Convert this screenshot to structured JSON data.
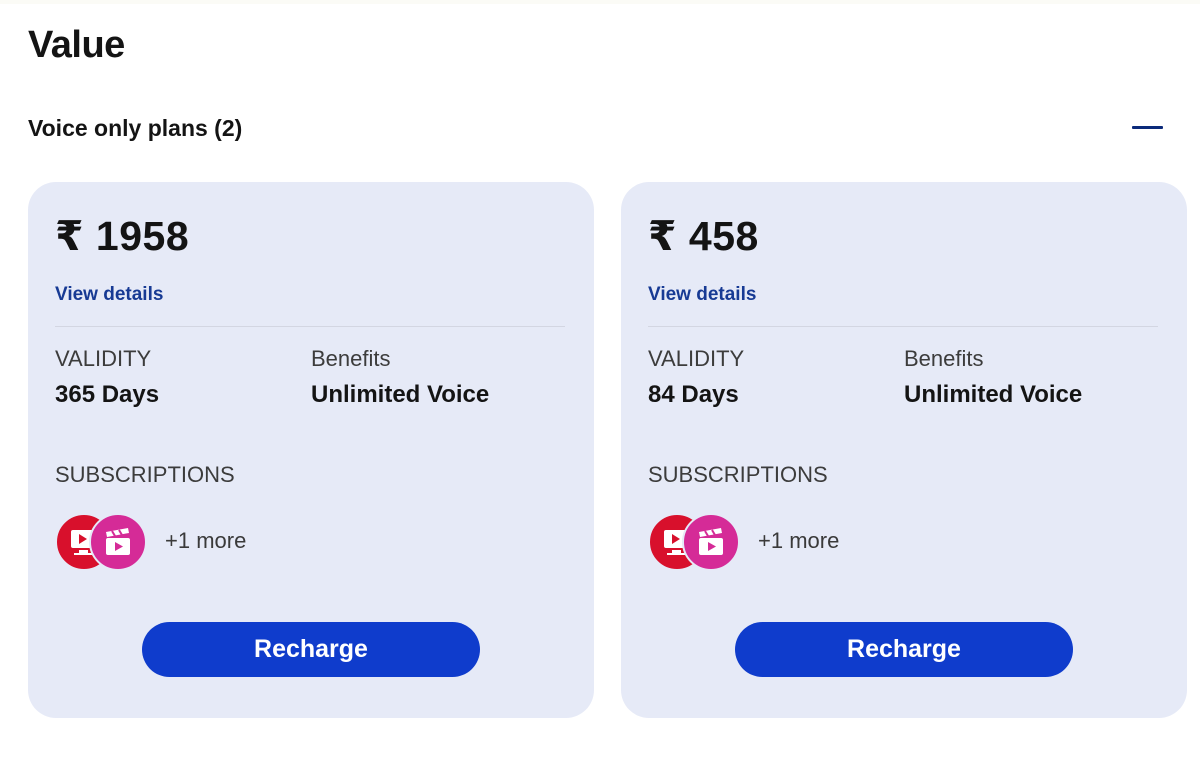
{
  "section": {
    "title": "Value"
  },
  "accordion": {
    "title": "Voice only plans (2)",
    "toggle_icon": "minus-icon",
    "toggle_color": "#0b2a7a"
  },
  "colors": {
    "card_background": "#e6eaf7",
    "button_background": "#0f3ccc",
    "link_color": "#173a94",
    "tv_icon_background": "#d8102c",
    "cinema_icon_background": "#d52b97"
  },
  "plans": [
    {
      "price": "₹ 1958",
      "view_details": "View details",
      "validity_label": "VALIDITY",
      "validity_value": "365 Days",
      "benefits_label": "Benefits",
      "benefits_value": "Unlimited Voice",
      "subscriptions_label": "SUBSCRIPTIONS",
      "subscription_icons": [
        "tv-play-icon",
        "cinema-clapper-icon"
      ],
      "more_text": "+1 more",
      "recharge_label": "Recharge"
    },
    {
      "price": "₹ 458",
      "view_details": "View details",
      "validity_label": "VALIDITY",
      "validity_value": "84 Days",
      "benefits_label": "Benefits",
      "benefits_value": "Unlimited Voice",
      "subscriptions_label": "SUBSCRIPTIONS",
      "subscription_icons": [
        "tv-play-icon",
        "cinema-clapper-icon"
      ],
      "more_text": "+1 more",
      "recharge_label": "Recharge"
    }
  ]
}
